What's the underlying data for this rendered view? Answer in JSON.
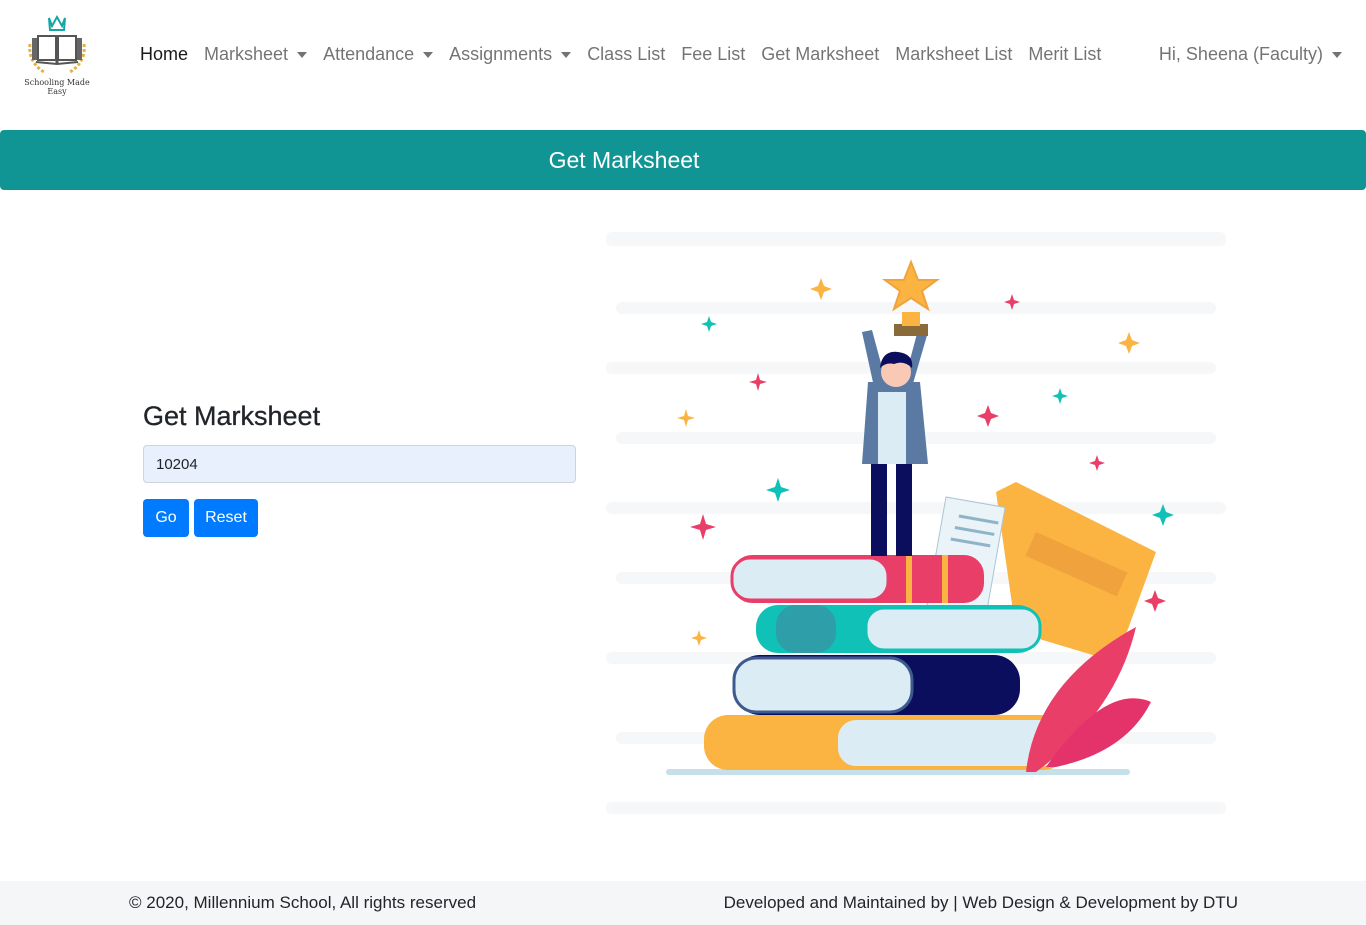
{
  "brand": {
    "tagline": "Schooling Made Easy"
  },
  "nav": {
    "items": [
      {
        "label": "Home",
        "dropdown": false
      },
      {
        "label": "Marksheet",
        "dropdown": true
      },
      {
        "label": "Attendance",
        "dropdown": true
      },
      {
        "label": "Assignments",
        "dropdown": true
      },
      {
        "label": "Class List",
        "dropdown": false
      },
      {
        "label": "Fee List",
        "dropdown": false
      },
      {
        "label": "Get Marksheet",
        "dropdown": false
      },
      {
        "label": "Marksheet List",
        "dropdown": false
      },
      {
        "label": "Merit List",
        "dropdown": false
      }
    ],
    "user": "Hi, Sheena (Faculty)"
  },
  "banner": {
    "title": "Get Marksheet"
  },
  "form": {
    "heading": "Get Marksheet",
    "input_value": "10204",
    "go_label": "Go",
    "reset_label": "Reset"
  },
  "footer": {
    "copyright": "© 2020, Millennium School, All rights reserved",
    "developer": "Developed and Maintained by | Web Design & Development by DTU"
  },
  "colors": {
    "banner": "#119594",
    "button": "#007bff",
    "input_bg": "#e8f0fe",
    "footer_bg": "#f5f6f8"
  },
  "icons": [
    "school-logo",
    "caret-down-icon",
    "student-trophy-illustration"
  ]
}
